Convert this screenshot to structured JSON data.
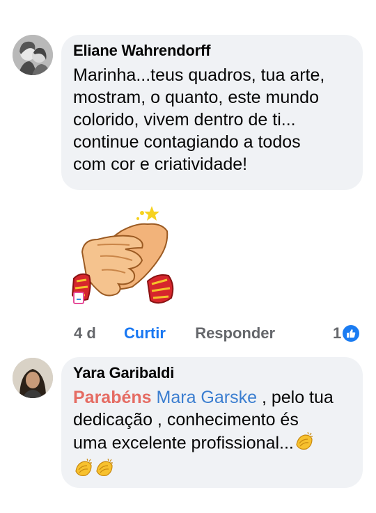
{
  "comments": [
    {
      "author": "Eliane Wahrendorff",
      "text_lines": [
        "Marinha...teus quadros, tua arte,",
        "mostram, o quanto, este mundo",
        "colorido, vivem dentro de ti...",
        "continue contagiando a todos",
        "com cor e criatividade!"
      ],
      "sticker_icon": "clapping-hands-sticker",
      "meta": {
        "time": "4 d",
        "like_label": "Curtir",
        "reply_label": "Responder",
        "reaction_count": "1",
        "reaction_icon": "like-icon"
      }
    },
    {
      "author": "Yara Garibaldi",
      "mention_1": "Parabéns",
      "mention_2": "Mara Garske",
      "text_after_mentions": " , pelo tua",
      "text_lines": [
        "dedicação , conhecimento és",
        "uma excelente profissional..."
      ],
      "emoji_icon": "clapping-hands-emoji"
    }
  ],
  "colors": {
    "bubble": "#f0f2f5",
    "link_blue": "#1877f2",
    "mention_red": "#e56c63",
    "mention_blue": "#3b7ed0",
    "meta_gray": "#65676b"
  }
}
